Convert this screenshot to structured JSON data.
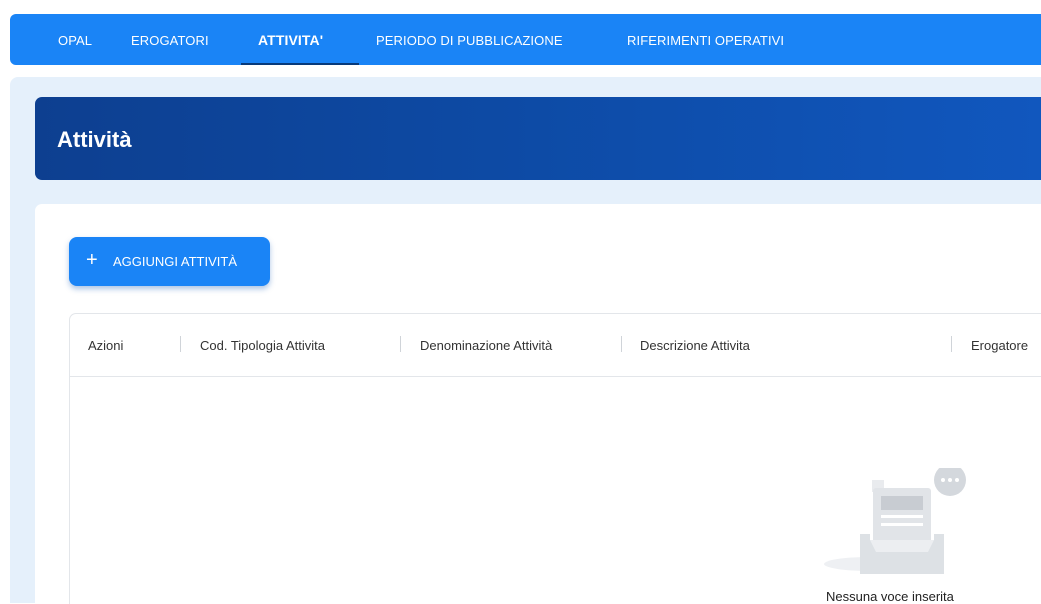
{
  "nav": {
    "items": [
      {
        "label": "OPAL"
      },
      {
        "label": "EROGATORI"
      },
      {
        "label": "ATTIVITA'"
      },
      {
        "label": "PERIODO DI PUBBLICAZIONE"
      },
      {
        "label": "RIFERIMENTI OPERATIVI"
      }
    ],
    "active_index": 2
  },
  "page": {
    "title": "Attività"
  },
  "actions": {
    "add_icon": "plus-icon",
    "add_label": "AGGIUNGI ATTIVITÀ"
  },
  "table": {
    "columns": [
      {
        "label": "Azioni"
      },
      {
        "label": "Cod. Tipologia Attivita"
      },
      {
        "label": "Denominazione Attività"
      },
      {
        "label": "Descrizione Attivita"
      },
      {
        "label": "Erogatore"
      }
    ],
    "rows": [],
    "empty_message": "Nessuna voce inserita",
    "empty_icon": "empty-inbox-icon"
  },
  "colors": {
    "primary": "#1a84f6",
    "header_dark": "#0d3f90",
    "content_bg": "#e5f0fb"
  }
}
